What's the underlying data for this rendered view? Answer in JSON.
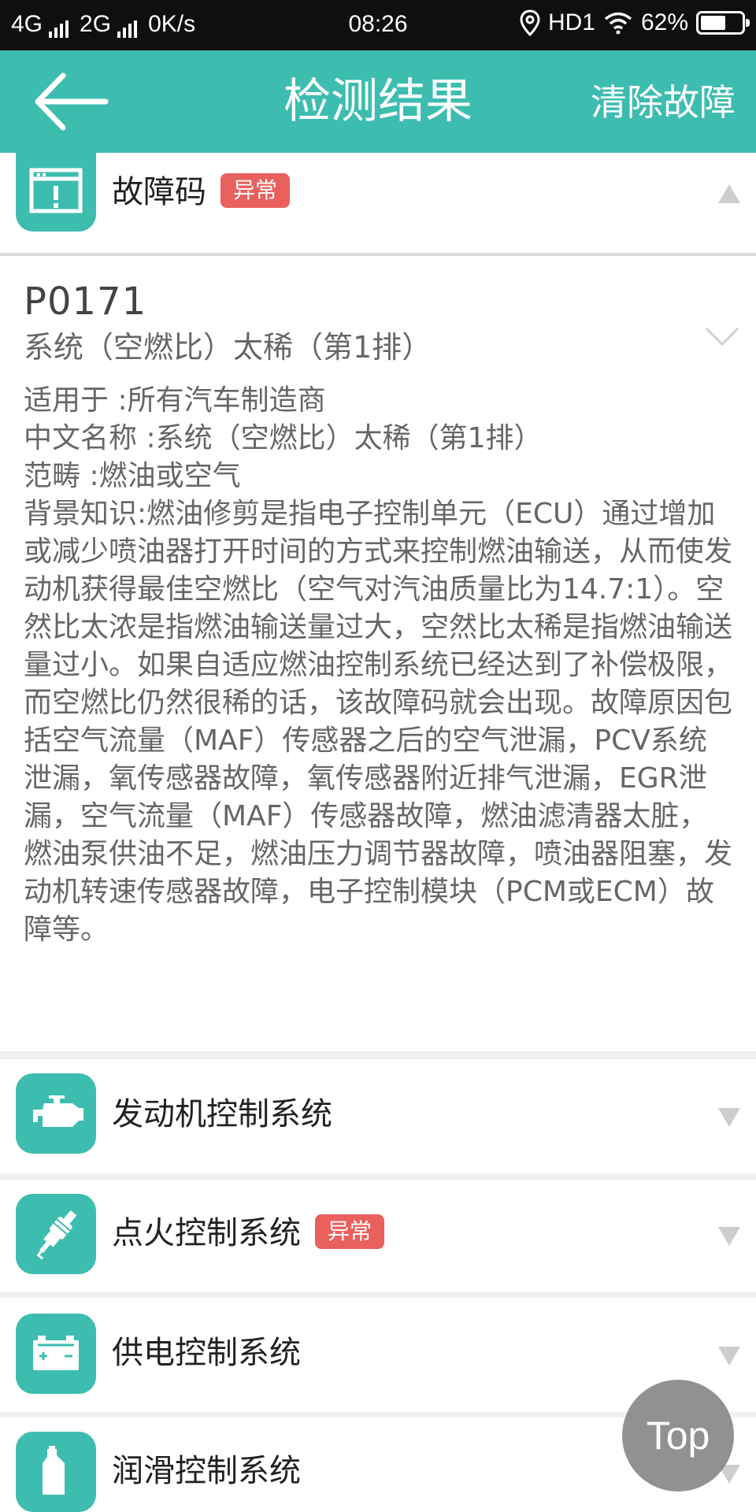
{
  "status_bar": {
    "net1": "4G",
    "net2": "2G",
    "speed": "0K/s",
    "time": "08:26",
    "carrier": "HD1",
    "battery": "62%",
    "battery_level": 0.62
  },
  "header": {
    "title": "检测结果",
    "clear_label": "清除故障"
  },
  "fault_section": {
    "title": "故障码",
    "badge": "异常",
    "code": "P0171",
    "subtitle": "系统（空燃比）太稀（第1排）",
    "description": "适用于 :所有汽车制造商\n中文名称 :系统（空燃比）太稀（第1排）\n范畴 :燃油或空气\n背景知识:燃油修剪是指电子控制单元（ECU）通过增加或减少喷油器打开时间的方式来控制燃油输送，从而使发动机获得最佳空燃比（空气对汽油质量比为14.7:1）。空然比太浓是指燃油输送量过大，空然比太稀是指燃油输送量过小。如果自适应燃油控制系统已经达到了补偿极限，而空燃比仍然很稀的话，该故障码就会出现。故障原因包括空气流量（MAF）传感器之后的空气泄漏，PCV系统泄漏，氧传感器故障，氧传感器附近排气泄漏，EGR泄漏，空气流量（MAF）传感器故障，燃油滤清器太脏，燃油泵供油不足，燃油压力调节器故障，喷油器阻塞，发动机转速传感器故障，电子控制模块（PCM或ECM）故障等。"
  },
  "systems": [
    {
      "title": "发动机控制系统",
      "badge": "",
      "icon": "engine-icon"
    },
    {
      "title": "点火控制系统",
      "badge": "异常",
      "icon": "spark-plug-icon"
    },
    {
      "title": "供电控制系统",
      "badge": "",
      "icon": "battery-icon"
    },
    {
      "title": "润滑控制系统",
      "badge": "",
      "icon": "oil-bottle-icon"
    }
  ],
  "top_button": "Top",
  "colors": {
    "accent": "#3dbdb0",
    "badge": "#e9605d",
    "top_button": "#828282"
  }
}
